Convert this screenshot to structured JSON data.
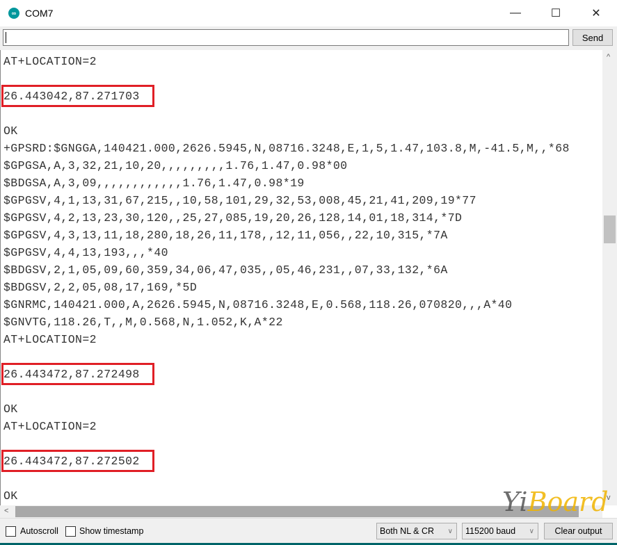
{
  "window": {
    "title": "COM7",
    "minimize_icon": "minimize-icon",
    "maximize_icon": "maximize-icon",
    "close_icon": "close-icon"
  },
  "send": {
    "input_value": "",
    "button_label": "Send"
  },
  "output": {
    "lines": [
      {
        "text": "AT+LOCATION=2",
        "highlight": false
      },
      {
        "text": "",
        "highlight": false
      },
      {
        "text": "26.443042,87.271703",
        "highlight": true
      },
      {
        "text": "",
        "highlight": false
      },
      {
        "text": "OK",
        "highlight": false
      },
      {
        "text": "+GPSRD:$GNGGA,140421.000,2626.5945,N,08716.3248,E,1,5,1.47,103.8,M,-41.5,M,,*68",
        "highlight": false
      },
      {
        "text": "$GPGSA,A,3,32,21,10,20,,,,,,,,,1.76,1.47,0.98*00",
        "highlight": false
      },
      {
        "text": "$BDGSA,A,3,09,,,,,,,,,,,,1.76,1.47,0.98*19",
        "highlight": false
      },
      {
        "text": "$GPGSV,4,1,13,31,67,215,,10,58,101,29,32,53,008,45,21,41,209,19*77",
        "highlight": false
      },
      {
        "text": "$GPGSV,4,2,13,23,30,120,,25,27,085,19,20,26,128,14,01,18,314,*7D",
        "highlight": false
      },
      {
        "text": "$GPGSV,4,3,13,11,18,280,18,26,11,178,,12,11,056,,22,10,315,*7A",
        "highlight": false
      },
      {
        "text": "$GPGSV,4,4,13,193,,,*40",
        "highlight": false
      },
      {
        "text": "$BDGSV,2,1,05,09,60,359,34,06,47,035,,05,46,231,,07,33,132,*6A",
        "highlight": false
      },
      {
        "text": "$BDGSV,2,2,05,08,17,169,*5D",
        "highlight": false
      },
      {
        "text": "$GNRMC,140421.000,A,2626.5945,N,08716.3248,E,0.568,118.26,070820,,,A*40",
        "highlight": false
      },
      {
        "text": "$GNVTG,118.26,T,,M,0.568,N,1.052,K,A*22",
        "highlight": false
      },
      {
        "text": "AT+LOCATION=2",
        "highlight": false
      },
      {
        "text": "",
        "highlight": false
      },
      {
        "text": "26.443472,87.272498",
        "highlight": true
      },
      {
        "text": "",
        "highlight": false
      },
      {
        "text": "OK",
        "highlight": false
      },
      {
        "text": "AT+LOCATION=2",
        "highlight": false
      },
      {
        "text": "",
        "highlight": false
      },
      {
        "text": "26.443472,87.272502",
        "highlight": true
      },
      {
        "text": "",
        "highlight": false
      },
      {
        "text": "OK",
        "highlight": false
      }
    ],
    "highlight_color": "#e01f26"
  },
  "bottom": {
    "autoscroll_label": "Autoscroll",
    "autoscroll_checked": false,
    "timestamp_label": "Show timestamp",
    "timestamp_checked": false,
    "line_ending": "Both NL & CR",
    "baud": "115200 baud",
    "clear_label": "Clear output"
  },
  "watermark": {
    "part1": "Yi",
    "part2": "Board"
  }
}
